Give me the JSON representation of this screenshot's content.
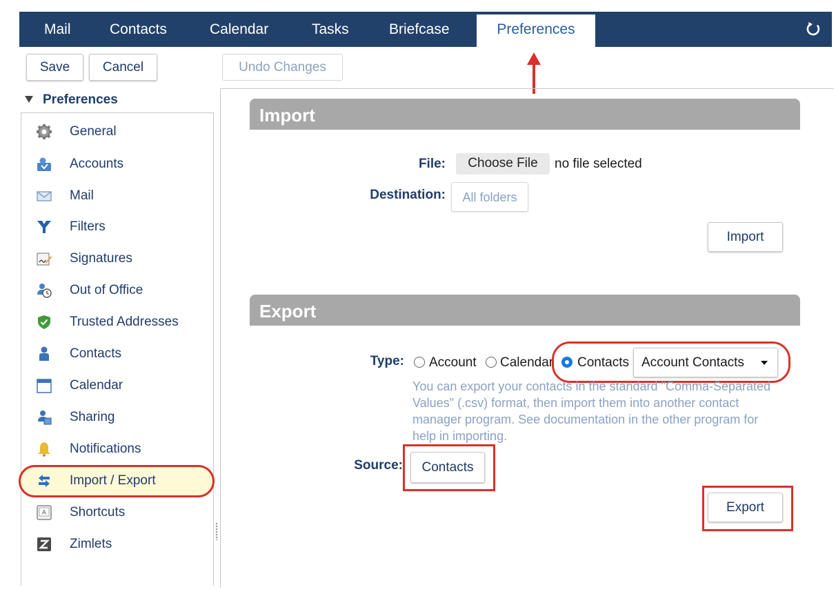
{
  "nav": {
    "tabs": [
      {
        "label": "Mail"
      },
      {
        "label": "Contacts"
      },
      {
        "label": "Calendar"
      },
      {
        "label": "Tasks"
      },
      {
        "label": "Briefcase"
      },
      {
        "label": "Preferences",
        "active": true
      }
    ],
    "refresh_icon": "refresh-icon"
  },
  "toolbar": {
    "save_label": "Save",
    "cancel_label": "Cancel",
    "undo_label": "Undo Changes"
  },
  "sidebar": {
    "heading": "Preferences",
    "items": [
      {
        "label": "General",
        "icon": "gear-icon"
      },
      {
        "label": "Accounts",
        "icon": "accounts-icon"
      },
      {
        "label": "Mail",
        "icon": "envelope-icon"
      },
      {
        "label": "Filters",
        "icon": "filter-icon"
      },
      {
        "label": "Signatures",
        "icon": "signature-icon"
      },
      {
        "label": "Out of Office",
        "icon": "out-of-office-icon"
      },
      {
        "label": "Trusted Addresses",
        "icon": "shield-check-icon"
      },
      {
        "label": "Contacts",
        "icon": "person-icon"
      },
      {
        "label": "Calendar",
        "icon": "calendar-icon"
      },
      {
        "label": "Sharing",
        "icon": "sharing-icon"
      },
      {
        "label": "Notifications",
        "icon": "bell-icon"
      },
      {
        "label": "Import / Export",
        "icon": "import-export-icon",
        "selected": true
      },
      {
        "label": "Shortcuts",
        "icon": "keyboard-key-icon"
      },
      {
        "label": "Zimlets",
        "icon": "zimlet-icon"
      }
    ]
  },
  "import": {
    "title": "Import",
    "file_label": "File:",
    "choose_file_label": "Choose File",
    "no_file_text": "no file selected",
    "destination_label": "Destination:",
    "destination_value": "All folders",
    "import_button": "Import"
  },
  "export": {
    "title": "Export",
    "type_label": "Type:",
    "options": [
      "Account",
      "Calendar",
      "Contacts"
    ],
    "selected_option": "Contacts",
    "format_select": "Account Contacts",
    "help_text": "You can export your contacts in the standard \"Comma-Separated Values\" (.csv) format, then import them into another contact manager program. See documentation in the other program for help in importing.",
    "source_label": "Source:",
    "source_value": "Contacts",
    "export_button": "Export"
  },
  "colors": {
    "nav_bg": "#22416a",
    "accent": "#1b76e6",
    "annotation_red": "#d9302a",
    "section_bar": "#a8a8a8"
  }
}
